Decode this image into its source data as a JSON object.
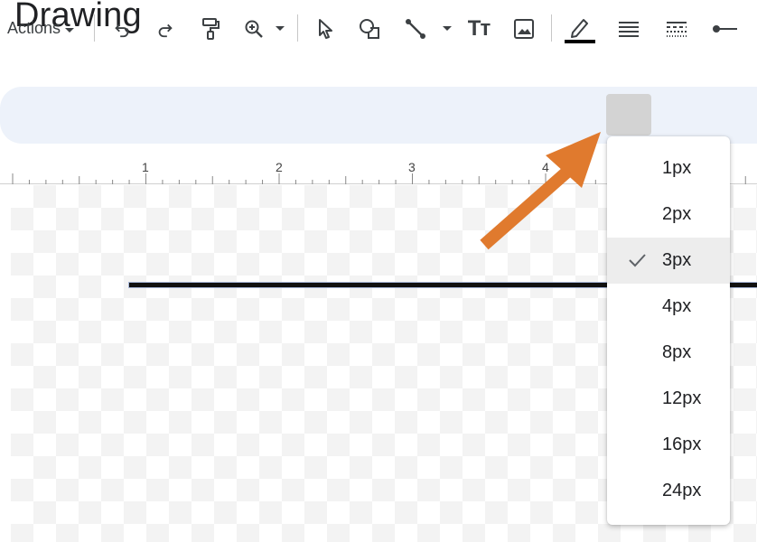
{
  "page": {
    "title": "Drawing"
  },
  "toolbar": {
    "actions_label": "Actions",
    "text_tool_glyph": "Tт",
    "buttons": [
      {
        "name": "undo-icon"
      },
      {
        "name": "redo-icon"
      },
      {
        "name": "paint-format-icon"
      },
      {
        "name": "zoom-icon"
      },
      {
        "name": "select-cursor-icon"
      },
      {
        "name": "shape-icon"
      },
      {
        "name": "line-icon"
      },
      {
        "name": "text-box-icon"
      },
      {
        "name": "image-icon"
      },
      {
        "name": "line-color-icon"
      },
      {
        "name": "line-weight-icon"
      },
      {
        "name": "line-dash-icon"
      },
      {
        "name": "line-start-icon"
      }
    ],
    "line_color": "#000000"
  },
  "ruler": {
    "labels": [
      "1",
      "2",
      "3",
      "4"
    ]
  },
  "line_weight_menu": {
    "selected": "3px",
    "items": [
      "1px",
      "2px",
      "3px",
      "4px",
      "8px",
      "12px",
      "16px",
      "24px"
    ]
  },
  "annotation": {
    "arrow_color": "#e07a2e"
  }
}
